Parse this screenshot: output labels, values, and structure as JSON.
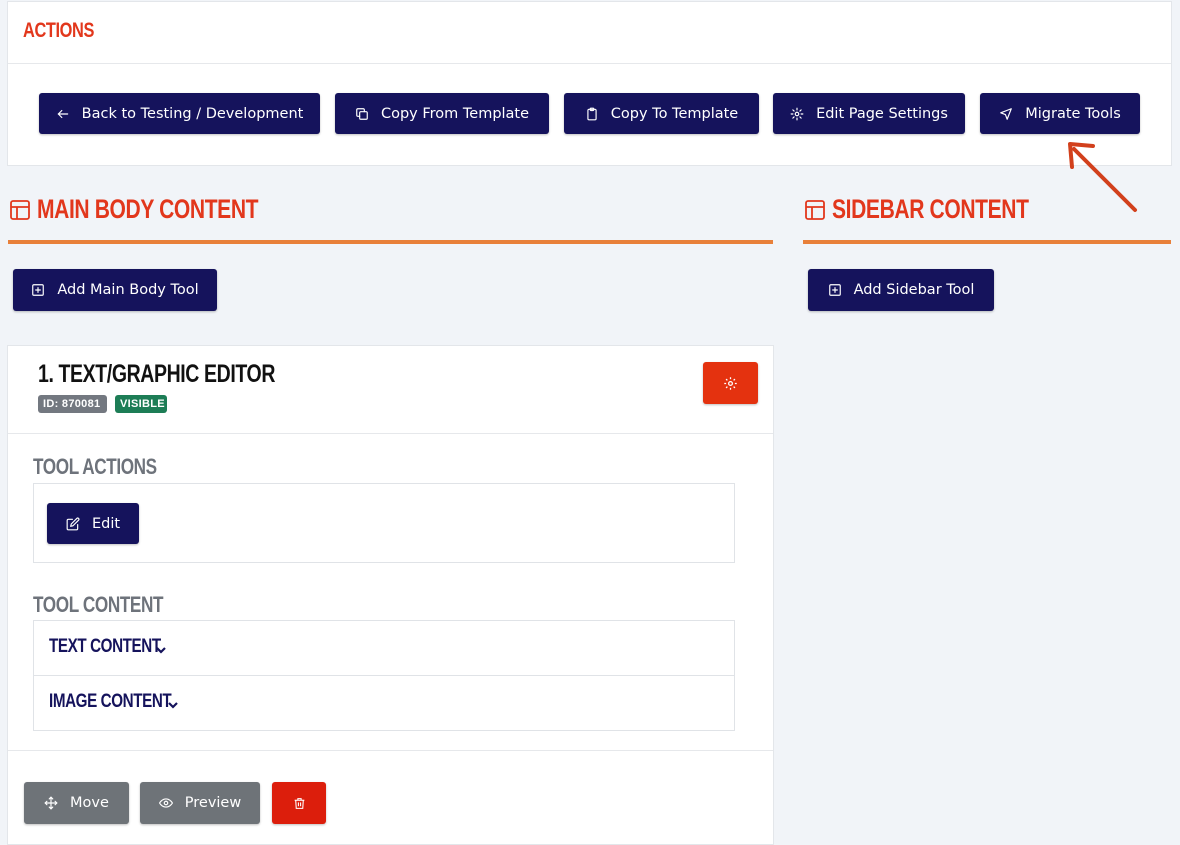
{
  "actions": {
    "title": "ACTIONS",
    "buttons": [
      {
        "label": "Back to Testing / Development",
        "icon": "arrow-left-icon"
      },
      {
        "label": "Copy From Template",
        "icon": "copy-icon"
      },
      {
        "label": "Copy To Template",
        "icon": "clipboard-icon"
      },
      {
        "label": "Edit Page Settings",
        "icon": "gear-icon"
      },
      {
        "label": "Migrate Tools",
        "icon": "send-icon"
      }
    ]
  },
  "main": {
    "title": "MAIN BODY CONTENT",
    "add_button": "Add Main Body Tool"
  },
  "sidebar": {
    "title": "SIDEBAR CONTENT",
    "add_button": "Add Sidebar Tool"
  },
  "tool": {
    "title": "1. TEXT/GRAPHIC EDITOR",
    "id_badge": "ID: 870081",
    "status_badge": "VISIBLE",
    "actions_title": "TOOL ACTIONS",
    "edit_label": "Edit",
    "content_title": "TOOL CONTENT",
    "sections": [
      "TEXT CONTENT",
      "IMAGE CONTENT"
    ],
    "move_label": "Move",
    "preview_label": "Preview"
  },
  "colors": {
    "navy": "#15135c",
    "accent_red": "#e2371c",
    "rule_orange": "#e8803a",
    "visible_green": "#1d7d56",
    "annotation_arrow": "#d2401c"
  }
}
